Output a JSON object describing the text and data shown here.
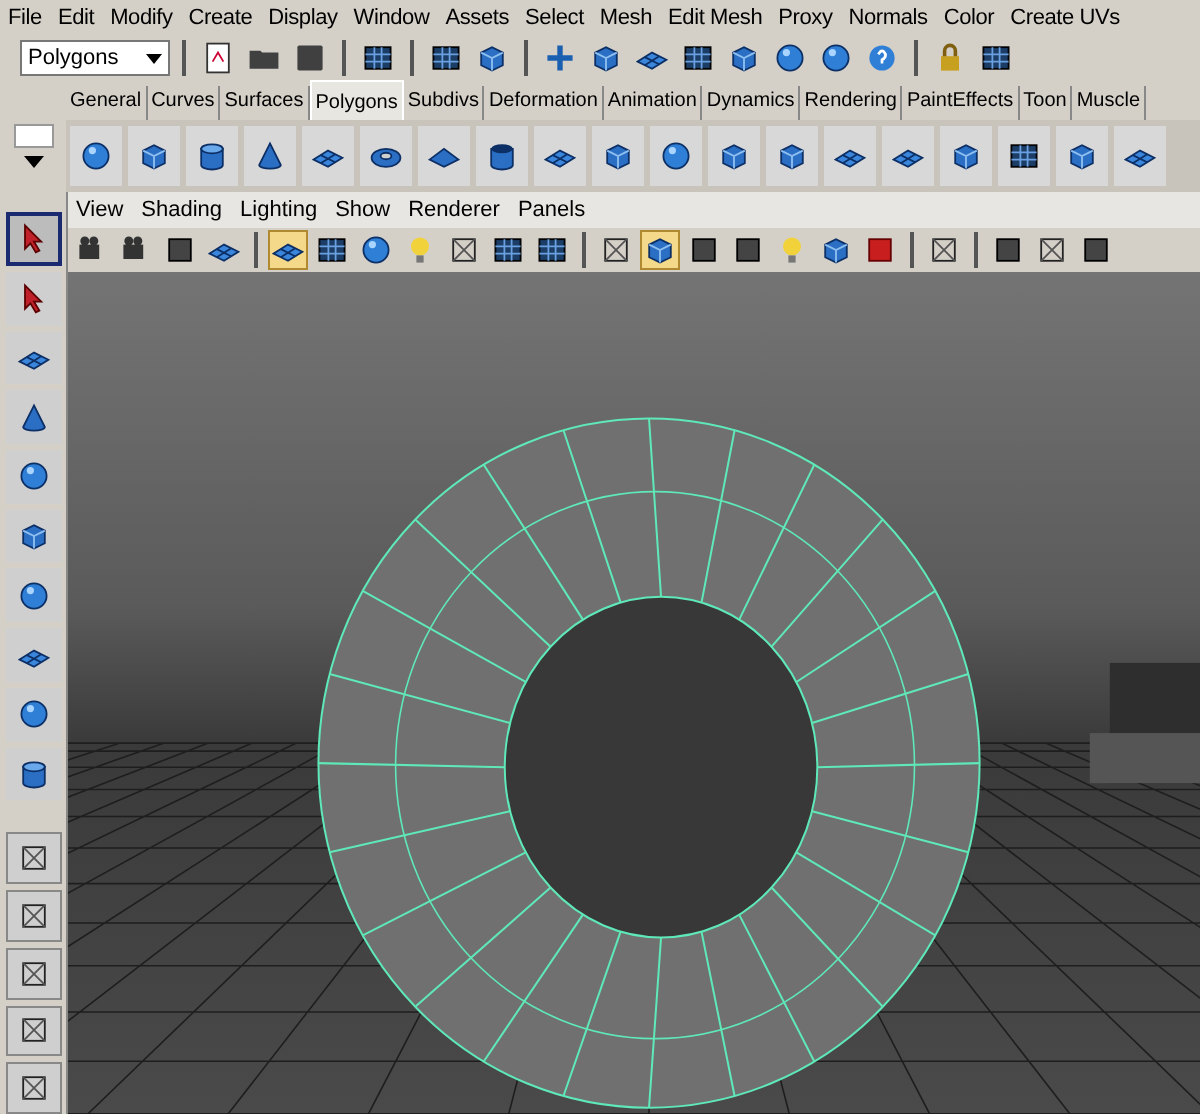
{
  "menu_bar": [
    "File",
    "Edit",
    "Modify",
    "Create",
    "Display",
    "Window",
    "Assets",
    "Select",
    "Mesh",
    "Edit Mesh",
    "Proxy",
    "Normals",
    "Color",
    "Create UVs"
  ],
  "status_line": {
    "mode_dropdown": "Polygons"
  },
  "shelf_tabs": [
    {
      "label": "General",
      "selected": false
    },
    {
      "label": "Curves",
      "selected": false
    },
    {
      "label": "Surfaces",
      "selected": false
    },
    {
      "label": "Polygons",
      "selected": true
    },
    {
      "label": "Subdivs",
      "selected": false
    },
    {
      "label": "Deformation",
      "selected": false
    },
    {
      "label": "Animation",
      "selected": false
    },
    {
      "label": "Dynamics",
      "selected": false
    },
    {
      "label": "Rendering",
      "selected": false
    },
    {
      "label": "PaintEffects",
      "selected": false
    },
    {
      "label": "Toon",
      "selected": false
    },
    {
      "label": "Muscle",
      "selected": false
    }
  ],
  "panel_menu": [
    "View",
    "Shading",
    "Lighting",
    "Show",
    "Renderer",
    "Panels"
  ]
}
